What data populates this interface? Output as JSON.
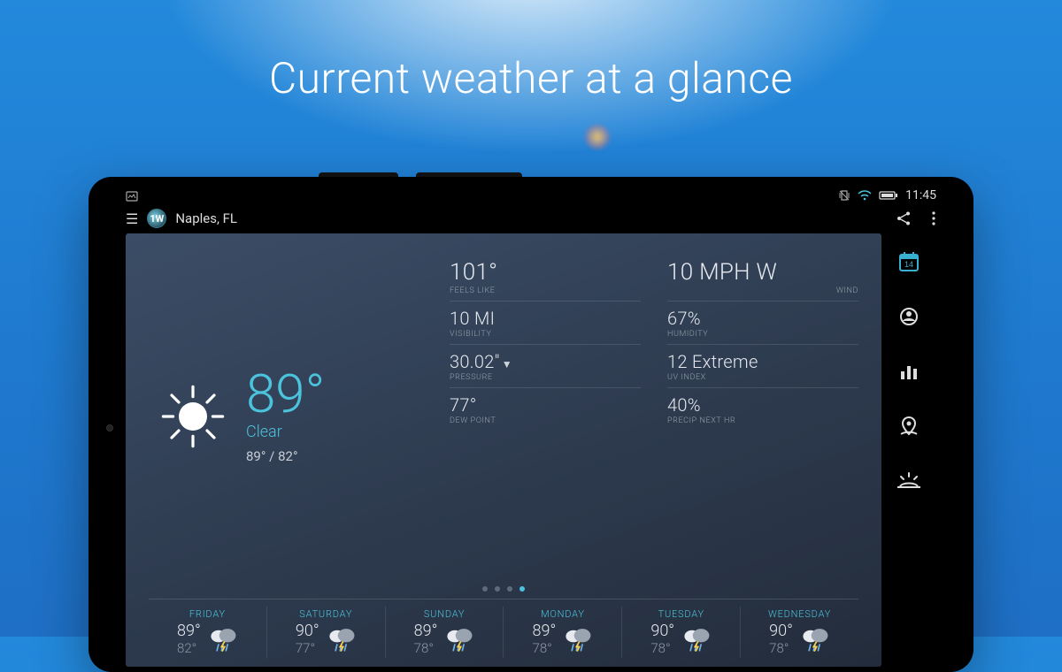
{
  "promo": {
    "title": "Current weather at a glance"
  },
  "status": {
    "time": "11:45"
  },
  "appbar": {
    "logo_text": "1W",
    "location": "Naples, FL"
  },
  "sidenav": {
    "calendar_day": "14"
  },
  "current": {
    "temp": "89°",
    "condition": "Clear",
    "hilo": "89° / 82°"
  },
  "metrics": {
    "feels_like": {
      "value": "101°",
      "label": "FEELS LIKE"
    },
    "wind": {
      "value": "10 MPH W",
      "label": "WIND"
    },
    "visibility": {
      "value": "10 MI",
      "label": "VISIBILITY"
    },
    "humidity": {
      "value": "67%",
      "label": "HUMIDITY"
    },
    "pressure": {
      "value": "30.02\"",
      "label": "PRESSURE",
      "trend": "▼"
    },
    "uv": {
      "value": "12 Extreme",
      "label": "UV INDEX"
    },
    "dewpoint": {
      "value": "77°",
      "label": "DEW POINT"
    },
    "precip": {
      "value": "40%",
      "label": "PRECIP NEXT HR"
    }
  },
  "pager": {
    "count": 4,
    "active": 3
  },
  "forecast": [
    {
      "day": "FRIDAY",
      "hi": "89°",
      "lo": "82°"
    },
    {
      "day": "SATURDAY",
      "hi": "90°",
      "lo": "77°"
    },
    {
      "day": "SUNDAY",
      "hi": "89°",
      "lo": "78°"
    },
    {
      "day": "MONDAY",
      "hi": "89°",
      "lo": "78°"
    },
    {
      "day": "TUESDAY",
      "hi": "90°",
      "lo": "78°"
    },
    {
      "day": "WEDNESDAY",
      "hi": "90°",
      "lo": "78°"
    }
  ]
}
